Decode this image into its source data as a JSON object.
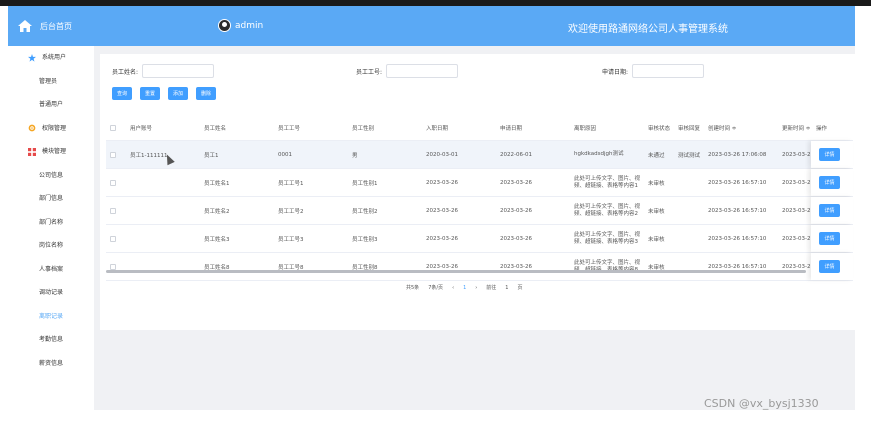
{
  "brand": {
    "label": "后台首页"
  },
  "header": {
    "user": "admin",
    "title": "欢迎使用路通网络公司人事管理系统"
  },
  "sidebar": {
    "groups": [
      {
        "label": "系统用户",
        "items": [
          "管理员",
          "普通用户"
        ]
      },
      {
        "label": "权限管理",
        "items": []
      },
      {
        "label": "模块管理",
        "items": [
          "公司信息",
          "部门信息",
          "部门名称",
          "岗位名称",
          "人事档案",
          "调动记录",
          "离职记录",
          "考勤信息",
          "薪资信息"
        ]
      }
    ],
    "active": "离职记录"
  },
  "search": {
    "name_label": "员工姓名:",
    "no_label": "员工工号:",
    "date_label": "申请日期:"
  },
  "buttons": {
    "query": "查询",
    "reset": "重置",
    "add": "添加",
    "delete": "删除"
  },
  "table": {
    "headers": [
      "用户账号",
      "员工姓名",
      "员工工号",
      "员工性别",
      "入职日期",
      "申请日期",
      "离职原因",
      "审核状态",
      "审核回复",
      "创建时间 ≑",
      "更新时间 ≑",
      "操作"
    ],
    "rows": [
      [
        "员工1-111111",
        "员工1",
        "0001",
        "男",
        "2020-03-01",
        "2022-06-01",
        "hgkdkadsdjgh测试",
        "未通过",
        "测试测试",
        "2023-03-26 17:06:08",
        "2023-03-2"
      ],
      [
        "",
        "员工姓名1",
        "员工工号1",
        "员工性别1",
        "2023-03-26",
        "2023-03-26",
        "此处可上传文字、图片、视频、超链接、表格等内容1",
        "未审核",
        "",
        "2023-03-26 16:57:10",
        "2023-03-2"
      ],
      [
        "",
        "员工姓名2",
        "员工工号2",
        "员工性别2",
        "2023-03-26",
        "2023-03-26",
        "此处可上传文字、图片、视频、超链接、表格等内容2",
        "未审核",
        "",
        "2023-03-26 16:57:10",
        "2023-03-2"
      ],
      [
        "",
        "员工姓名3",
        "员工工号3",
        "员工性别3",
        "2023-03-26",
        "2023-03-26",
        "此处可上传文字、图片、视频、超链接、表格等内容3",
        "未审核",
        "",
        "2023-03-26 16:57:10",
        "2023-03-2"
      ],
      [
        "",
        "员工姓名8",
        "员工工号8",
        "员工性别8",
        "2023-03-26",
        "2023-03-26",
        "此处可上传文字、图片、视频、超链接、表格等内容8",
        "未审核",
        "",
        "2023-03-26 16:57:10",
        "2023-03-2"
      ]
    ],
    "detail_label": "详情"
  },
  "pager": {
    "total": "共5条",
    "page_size": "7条/页",
    "prev": "‹",
    "current": "1",
    "next": "›",
    "goto": "前往",
    "goto_value": "1",
    "page_unit": "页"
  },
  "watermark": "CSDN @vx_bysj1330",
  "colors": {
    "primary": "#5aa9f5",
    "button": "#409eff",
    "content_bg": "#f0f1f4"
  }
}
